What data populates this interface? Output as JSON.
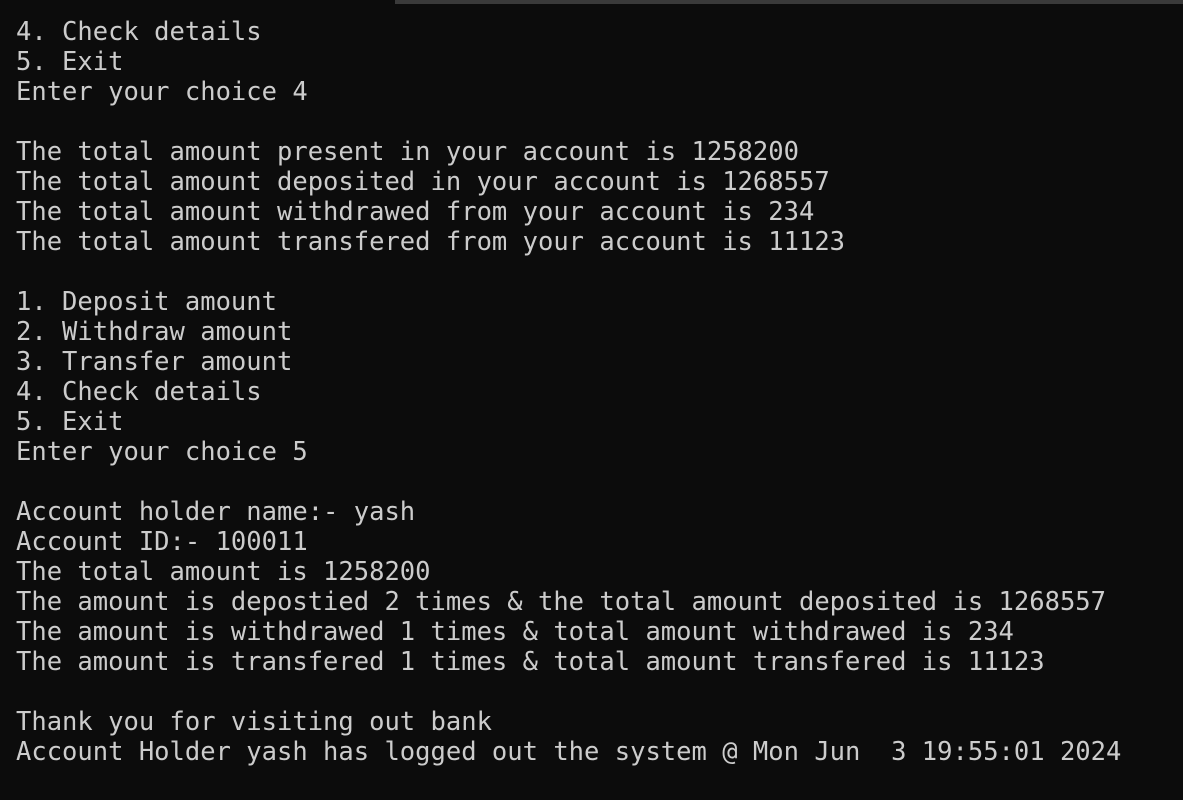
{
  "terminal": {
    "lines": [
      "4. Check details",
      "5. Exit",
      "Enter your choice 4",
      "",
      "The total amount present in your account is 1258200",
      "The total amount deposited in your account is 1268557",
      "The total amount withdrawed from your account is 234",
      "The total amount transfered from your account is 11123",
      "",
      "1. Deposit amount",
      "2. Withdraw amount",
      "3. Transfer amount",
      "4. Check details",
      "5. Exit",
      "Enter your choice 5",
      "",
      "Account holder name:- yash",
      "Account ID:- 100011",
      "The total amount is 1258200",
      "The amount is depostied 2 times & the total amount deposited is 1268557",
      "The amount is withdrawed 1 times & total amount withdrawed is 234",
      "The amount is transfered 1 times & total amount transfered is 11123",
      "",
      "Thank you for visiting out bank",
      "Account Holder yash has logged out the system @ Mon Jun  3 19:55:01 2024"
    ]
  },
  "colors": {
    "background": "#0c0c0c",
    "text": "#cccccc"
  }
}
